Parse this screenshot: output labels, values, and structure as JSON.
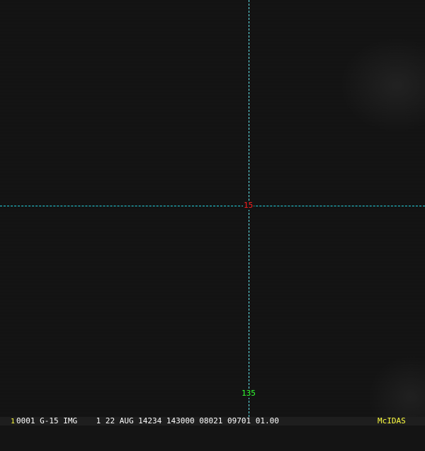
{
  "overlay": {
    "latitude_label": "15",
    "longitude_label": "135",
    "latitude_line_color": "#22d3e0",
    "longitude_line_color": "#5fe0e8"
  },
  "status_bar": {
    "frame_number": "1",
    "info": "0001 G-15 IMG    1 22 AUG 14234 143000 08021 09701 01.00",
    "brand": "McIDAS"
  }
}
